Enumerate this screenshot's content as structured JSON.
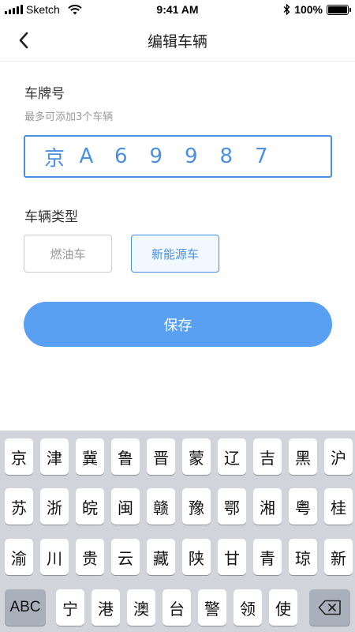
{
  "status_bar": {
    "carrier": "Sketch",
    "time": "9:41 AM",
    "battery": "100%",
    "battery_level": 1.0,
    "icons": [
      "signal-icon",
      "wifi-icon",
      "bluetooth-icon",
      "battery-icon"
    ]
  },
  "nav": {
    "title": "编辑车辆",
    "back_icon": "chevron-left-icon"
  },
  "plate": {
    "label": "车牌号",
    "hint": "最多可添加3个车辆",
    "chars": [
      "京",
      "A",
      "6",
      "9",
      "9",
      "8",
      "7"
    ]
  },
  "vehicle_type": {
    "label": "车辆类型",
    "options": [
      "燃油车",
      "新能源车"
    ],
    "selected": "新能源车"
  },
  "save_label": "保存",
  "keyboard": {
    "rows": [
      [
        "京",
        "津",
        "冀",
        "鲁",
        "晋",
        "蒙",
        "辽",
        "吉",
        "黑",
        "沪"
      ],
      [
        "苏",
        "浙",
        "皖",
        "闽",
        "赣",
        "豫",
        "鄂",
        "湘",
        "粤",
        "桂"
      ],
      [
        "渝",
        "川",
        "贵",
        "云",
        "藏",
        "陕",
        "甘",
        "青",
        "琼",
        "新"
      ],
      [
        "宁",
        "港",
        "澳",
        "台",
        "警",
        "领",
        "使"
      ]
    ],
    "abc_label": "ABC",
    "delete_icon": "backspace-icon"
  },
  "colors": {
    "accent": "#4a90e2",
    "save_button": "#5aa0f2",
    "keyboard_bg": "#d1d4da"
  }
}
